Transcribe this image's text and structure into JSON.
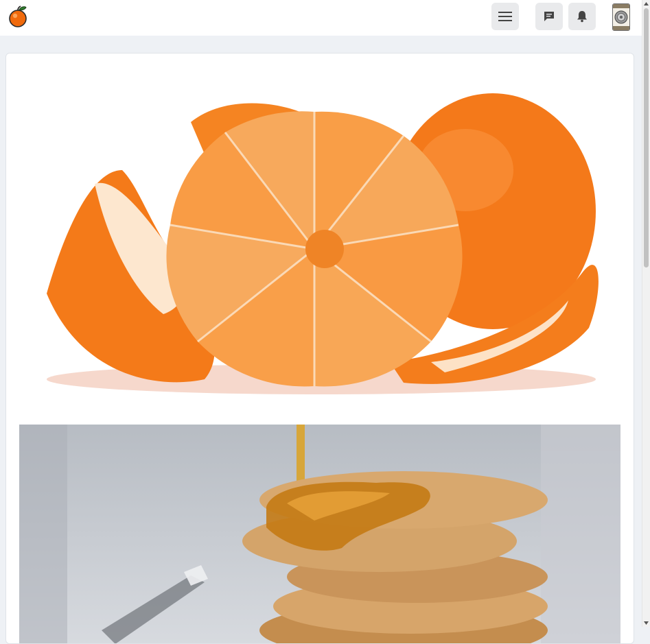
{
  "app": {
    "logo_icon": "orange-logo-icon",
    "accent_color": "#f06a0c"
  },
  "header": {
    "menu_icon": "hamburger-menu-icon",
    "messages_icon": "chat-bubble-icon",
    "notifications_icon": "bell-icon",
    "avatar_icon": "user-avatar",
    "button_bg": "#e9eaec"
  },
  "feed": {
    "images": [
      {
        "subject": "tangerine-peeled-photo"
      },
      {
        "subject": "pancakes-honey-photo"
      }
    ]
  }
}
